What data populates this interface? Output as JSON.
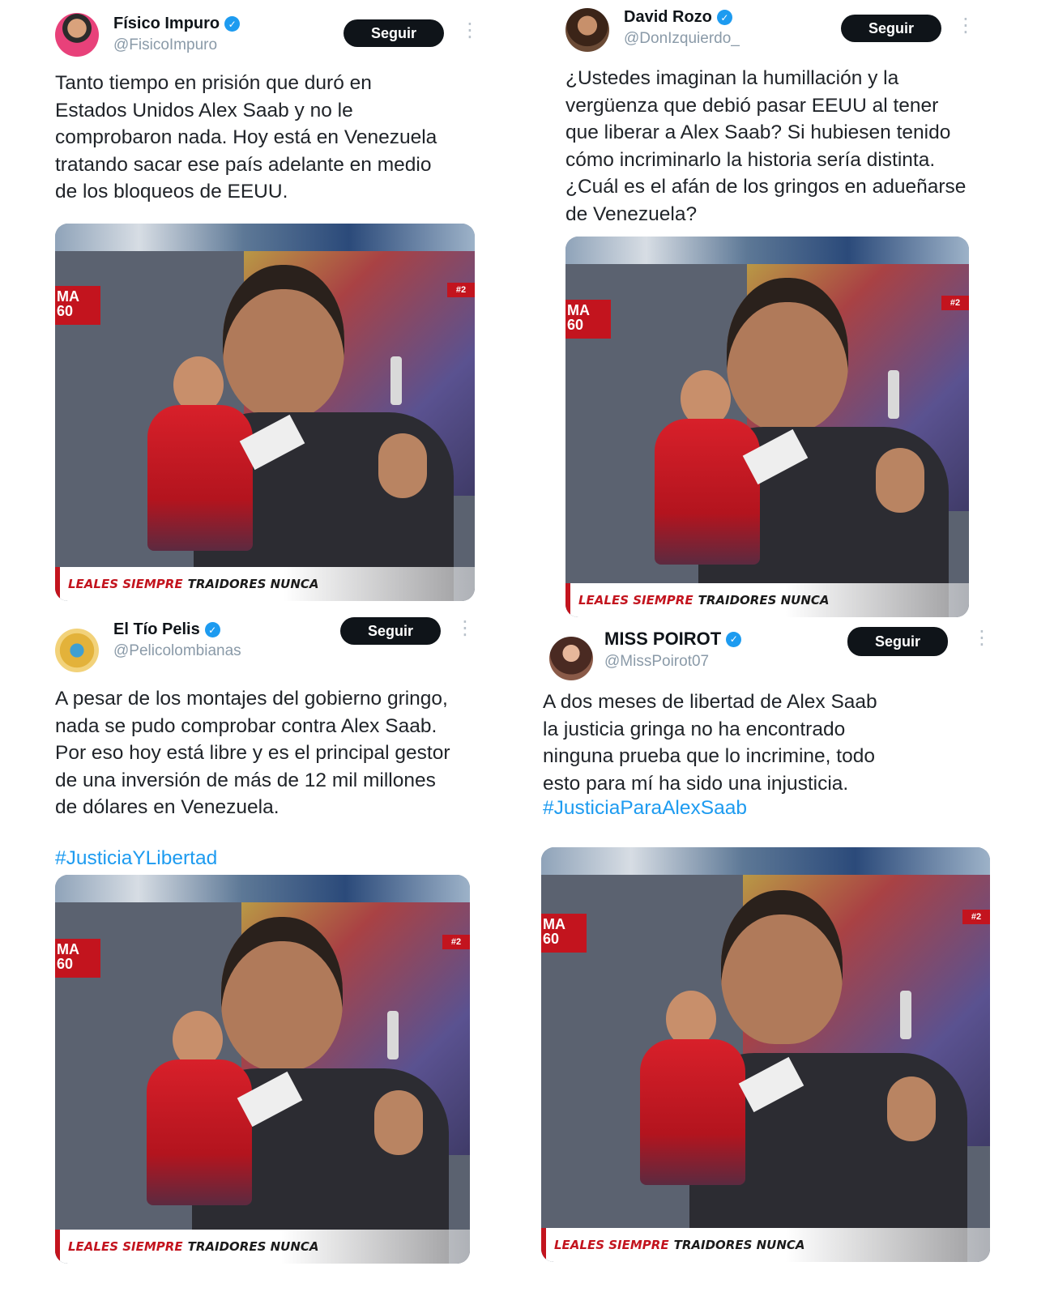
{
  "follow_label": "Seguir",
  "more_glyph": "⋮",
  "colors": {
    "accent": "#1d9bf0",
    "button": "#0f1419",
    "banner_red": "#c3141e"
  },
  "icons": [
    "verified-badge-icon",
    "more-options-icon"
  ],
  "tweets": [
    {
      "name": "Físico Impuro",
      "handle": "@FisicoImpuro",
      "text": "Tanto tiempo en prisión que duró en\nEstados Unidos Alex Saab y no le\ncomprobaron nada. Hoy está en Venezuela\ntratando sacar ese país adelante en medio\nde los bloqueos de EEUU.",
      "hashtag": "",
      "media": {
        "banner_left": "LEALES SIEMPRE",
        "banner_right": "TRAIDORES NUNCA",
        "corner_left": "MA\n60",
        "corner_right": "#2"
      }
    },
    {
      "name": "David Rozo",
      "handle": "@DonIzquierdo_",
      "text": "¿Ustedes imaginan la humillación y la\nvergüenza que debió pasar EEUU al tener\nque liberar a Alex Saab? Si hubiesen tenido\ncómo incriminarlo la historia sería distinta.\n¿Cuál es el afán de los gringos en adueñarse\nde Venezuela?",
      "hashtag": "",
      "media": {
        "banner_left": "LEALES SIEMPRE",
        "banner_right": "TRAIDORES NUNCA",
        "corner_left": "MA\n60",
        "corner_right": "#2"
      }
    },
    {
      "name": "El Tío Pelis",
      "handle": "@Pelicolombianas",
      "text": "A pesar de los montajes del gobierno gringo,\nnada se pudo comprobar contra Alex Saab.\nPor eso hoy está libre y es el principal gestor\nde una inversión de más de 12 mil millones\nde dólares en Venezuela.",
      "hashtag": "#JusticiaYLibertad",
      "media": {
        "banner_left": "LEALES SIEMPRE",
        "banner_right": "TRAIDORES NUNCA",
        "corner_left": "MA\n60",
        "corner_right": "#2"
      }
    },
    {
      "name": "MISS POIROT",
      "handle": "@MissPoirot07",
      "text": "A dos meses de libertad de Alex Saab\nla justicia gringa no ha encontrado\nninguna prueba que lo incrimine, todo\nesto para mí ha sido una injusticia.",
      "hashtag": "#JusticiaParaAlexSaab",
      "media": {
        "banner_left": "LEALES SIEMPRE",
        "banner_right": "TRAIDORES NUNCA",
        "corner_left": "MA\n60",
        "corner_right": "#2"
      }
    }
  ]
}
